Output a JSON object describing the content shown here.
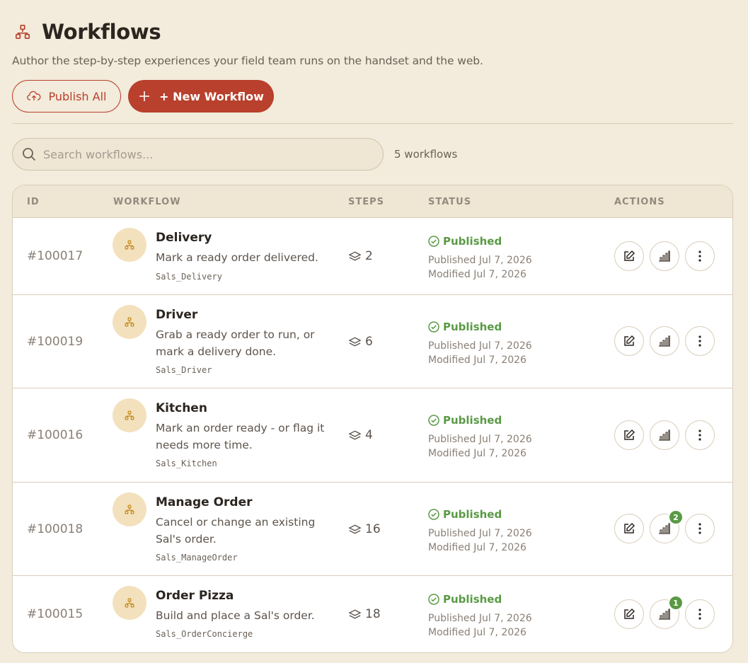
{
  "header": {
    "title": "Workflows",
    "subtitle": "Author the step-by-step experiences your field team runs on the handset and the web."
  },
  "toolbar": {
    "publish_all_label": "Publish All",
    "new_workflow_label": "+ New Workflow"
  },
  "search": {
    "placeholder": "Search workflows...",
    "value": "",
    "count_label": "5 workflows"
  },
  "table": {
    "columns": {
      "id": "ID",
      "workflow": "WORKFLOW",
      "steps": "STEPS",
      "status": "STATUS",
      "actions": "ACTIONS"
    },
    "rows": [
      {
        "id": "#100017",
        "name": "Delivery",
        "description": "Mark a ready order delivered.",
        "code": "Sals_Delivery",
        "steps": "2",
        "status": "Published",
        "published": "Published Jul 7, 2026",
        "modified": "Modified Jul 7, 2026",
        "badge": null
      },
      {
        "id": "#100019",
        "name": "Driver",
        "description": "Grab a ready order to run, or mark a delivery done.",
        "code": "Sals_Driver",
        "steps": "6",
        "status": "Published",
        "published": "Published Jul 7, 2026",
        "modified": "Modified Jul 7, 2026",
        "badge": null
      },
      {
        "id": "#100016",
        "name": "Kitchen",
        "description": "Mark an order ready - or flag it needs more time.",
        "code": "Sals_Kitchen",
        "steps": "4",
        "status": "Published",
        "published": "Published Jul 7, 2026",
        "modified": "Modified Jul 7, 2026",
        "badge": null
      },
      {
        "id": "#100018",
        "name": "Manage Order",
        "description": "Cancel or change an existing Sal's order.",
        "code": "Sals_ManageOrder",
        "steps": "16",
        "status": "Published",
        "published": "Published Jul 7, 2026",
        "modified": "Modified Jul 7, 2026",
        "badge": "2"
      },
      {
        "id": "#100015",
        "name": "Order Pizza",
        "description": "Build and place a Sal's order.",
        "code": "Sals_OrderConcierge",
        "steps": "18",
        "status": "Published",
        "published": "Published Jul 7, 2026",
        "modified": "Modified Jul 7, 2026",
        "badge": "1"
      }
    ]
  },
  "colors": {
    "background": "#f3ebdb",
    "accent": "#b8402c",
    "success": "#5a9a45",
    "avatar": "#f3e1bd"
  },
  "icons": {
    "title": "workflow-icon",
    "publish": "cloud-upload-icon",
    "new": "plus-icon",
    "search": "search-icon",
    "steps": "layers-icon",
    "status": "check-circle-icon",
    "edit": "edit-icon",
    "analytics": "bar-chart-icon",
    "more": "more-vertical-icon"
  }
}
